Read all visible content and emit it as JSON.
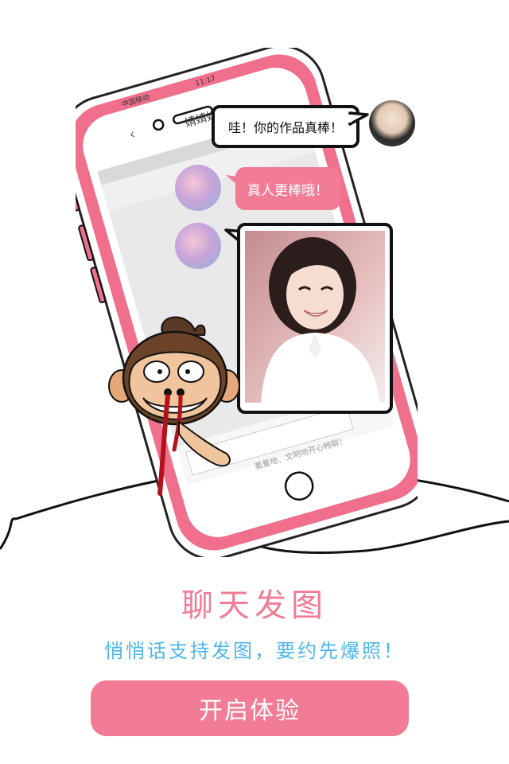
{
  "phone_status": {
    "carrier": "中国移动",
    "time": "11:17"
  },
  "chat_header": {
    "back_icon": "chevron-left-icon",
    "contact_name": "婧婧姑"
  },
  "messages": [
    {
      "from": "other",
      "text": "哇！你的作品真棒！"
    },
    {
      "from": "me",
      "text": "真人更棒哦！"
    },
    {
      "from": "me",
      "type": "image",
      "alt": "photo"
    }
  ],
  "input": {
    "placeholder": "羞羞地、文明地开心畅聊！"
  },
  "feature": {
    "title": "聊天发图",
    "subtitle": "悄悄话支持发图，要约先爆照！"
  },
  "cta": {
    "label": "开启体验"
  },
  "colors": {
    "accent_pink": "#f27c96",
    "subtitle_blue": "#4fb6e8",
    "phone_frame": "#f06f8c"
  }
}
